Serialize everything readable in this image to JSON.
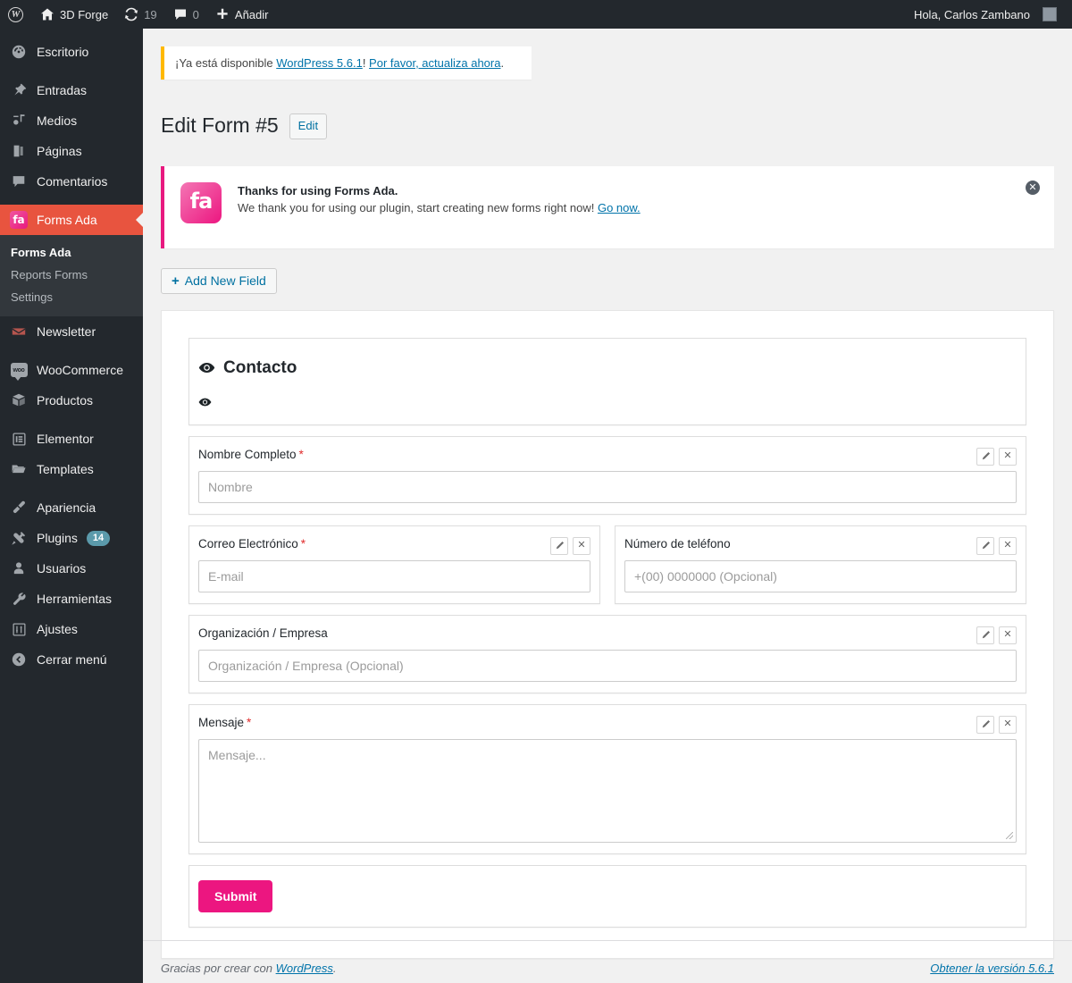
{
  "adminbar": {
    "logo_icon": "wordpress-logo-icon",
    "site_icon": "home-icon",
    "site_name": "3D Forge",
    "updates_icon": "updates-icon",
    "updates_count": "19",
    "comments_icon": "comment-bubble-icon",
    "comments_count": "0",
    "new_icon": "plus-icon",
    "new_label": "Añadir",
    "greeting": "Hola, Carlos Zambano",
    "avatar_name": "avatar"
  },
  "sidebar": {
    "items": [
      {
        "label": "Escritorio",
        "icon": "dashboard-icon",
        "active": false
      },
      {
        "label": "Entradas",
        "icon": "pin-icon",
        "active": false
      },
      {
        "label": "Medios",
        "icon": "media-icon",
        "active": false
      },
      {
        "label": "Páginas",
        "icon": "pages-icon",
        "active": false
      },
      {
        "label": "Comentarios",
        "icon": "comment-icon",
        "active": false
      },
      {
        "label": "Forms Ada",
        "icon": "forms-ada-icon",
        "active": true
      },
      {
        "label": "Newsletter",
        "icon": "newsletter-icon",
        "active": false
      },
      {
        "label": "WooCommerce",
        "icon": "woocommerce-icon",
        "active": false
      },
      {
        "label": "Productos",
        "icon": "products-box-icon",
        "active": false
      },
      {
        "label": "Elementor",
        "icon": "elementor-icon",
        "active": false
      },
      {
        "label": "Templates",
        "icon": "folder-icon",
        "active": false
      },
      {
        "label": "Apariencia",
        "icon": "paintbrush-icon",
        "active": false
      },
      {
        "label": "Plugins",
        "icon": "plugin-icon",
        "active": false,
        "badge": "14"
      },
      {
        "label": "Usuarios",
        "icon": "user-icon",
        "active": false
      },
      {
        "label": "Herramientas",
        "icon": "wrench-icon",
        "active": false
      },
      {
        "label": "Ajustes",
        "icon": "settings-sliders-icon",
        "active": false
      },
      {
        "label": "Cerrar menú",
        "icon": "collapse-arrow-icon",
        "active": false
      }
    ],
    "submenu": [
      {
        "label": "Forms Ada",
        "current": true
      },
      {
        "label": "Reports Forms",
        "current": false
      },
      {
        "label": "Settings",
        "current": false
      }
    ]
  },
  "update_nag": {
    "text_before": "¡Ya está disponible ",
    "link_version": "WordPress 5.6.1",
    "text_mid": "! ",
    "link_update": "Por favor, actualiza ahora",
    "text_after": "."
  },
  "header": {
    "title": "Edit Form #5",
    "edit_button": "Edit"
  },
  "plugin_notice": {
    "logo_text": "fa",
    "logo_name": "forms-ada-logo",
    "title": "Thanks for using Forms Ada.",
    "body": "We thank you for using our plugin, start creating new forms right now!",
    "link": "Go now.",
    "close_icon": "close-icon",
    "accent": "#e8197f"
  },
  "toolbar": {
    "add_field_label": "Add New Field",
    "add_field_icon": "plus-icon"
  },
  "form": {
    "section": {
      "title": "Contacto",
      "eye_icon": "eye-icon",
      "eye_icon_small": "eye-icon-small"
    },
    "edit_icon": "pencil-icon",
    "delete_icon": "close-x-icon",
    "required_mark": "*",
    "fields": [
      {
        "label": "Nombre Completo",
        "required": true,
        "placeholder": "Nombre",
        "type": "text",
        "width": "full"
      },
      {
        "label": "Correo Electrónico",
        "required": true,
        "placeholder": "E-mail",
        "type": "text",
        "width": "half"
      },
      {
        "label": "Número de teléfono",
        "required": false,
        "placeholder": "+(00) 0000000 (Opcional)",
        "type": "text",
        "width": "half"
      },
      {
        "label": "Organización / Empresa",
        "required": false,
        "placeholder": "Organización / Empresa (Opcional)",
        "type": "text",
        "width": "full"
      },
      {
        "label": "Mensaje",
        "required": true,
        "placeholder": "Mensaje...",
        "type": "textarea",
        "width": "full"
      }
    ],
    "submit_label": "Submit",
    "submit_color": "#ec1680"
  },
  "footer": {
    "thanks_before": "Gracias por crear con ",
    "thanks_link": "WordPress",
    "thanks_after": ".",
    "version_link": "Obtener la versión 5.6.1"
  }
}
